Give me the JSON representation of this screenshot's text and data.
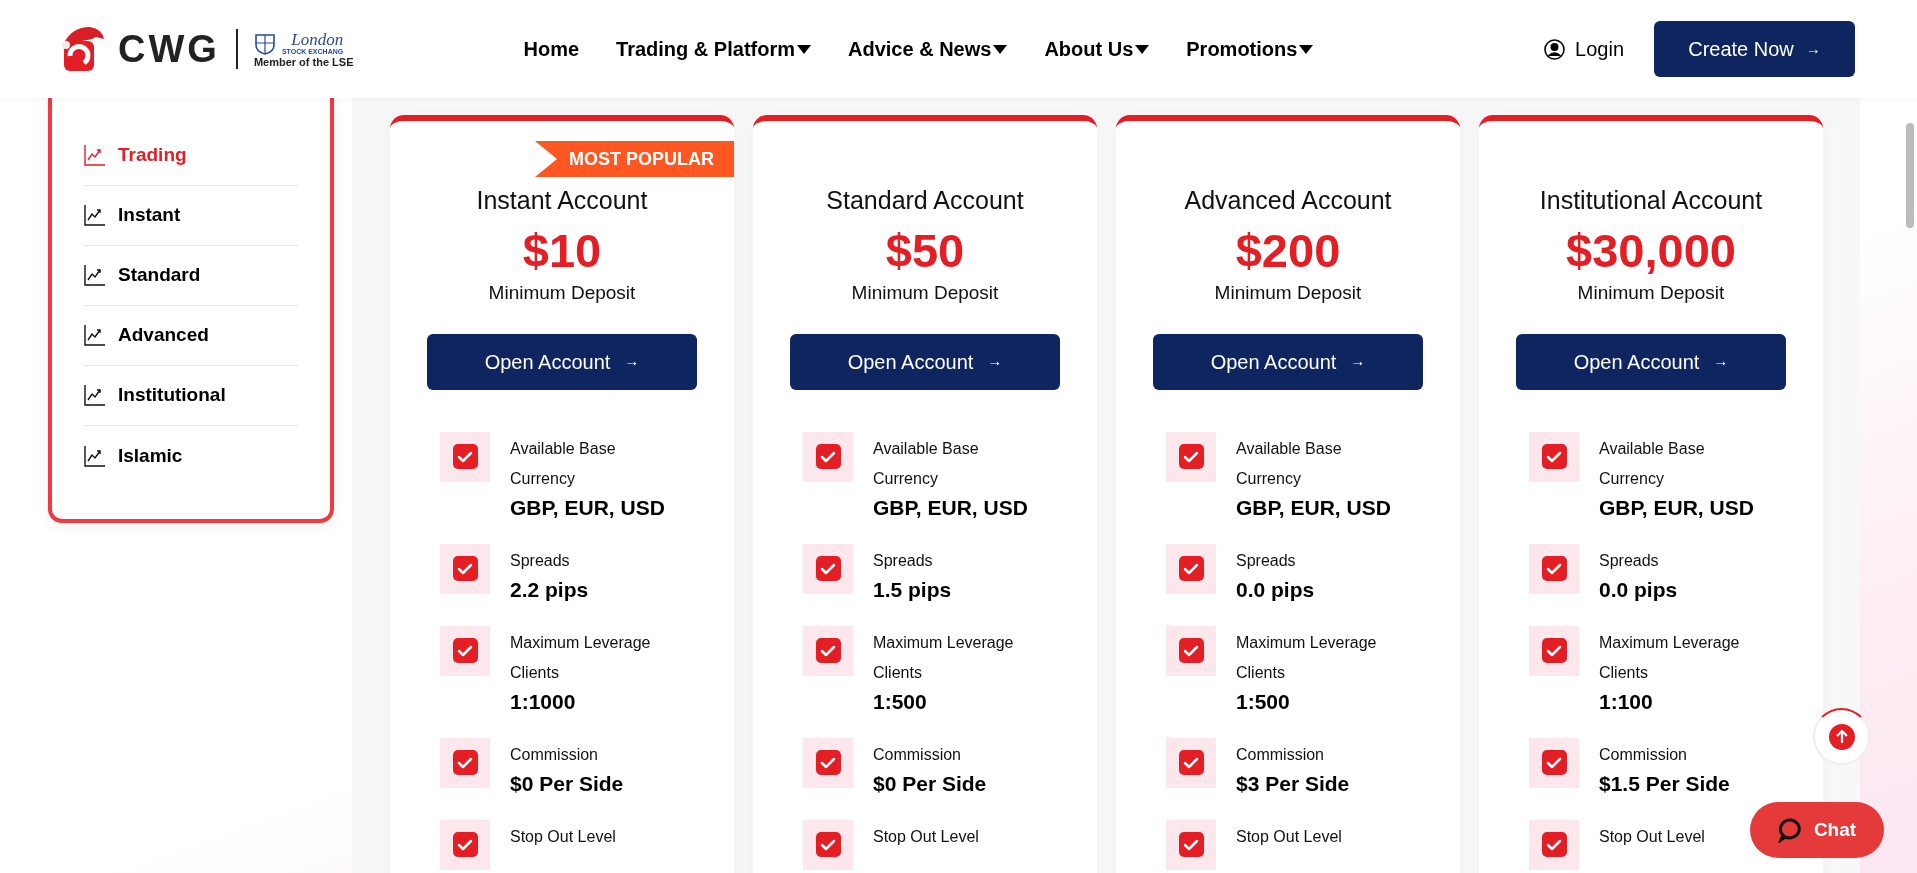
{
  "logo": {
    "brand": "CWG",
    "exchange": "London",
    "exchange_sub": "STOCK EXCHANG",
    "member": "Member of the LSE"
  },
  "nav": [
    {
      "label": "Home",
      "dropdown": false
    },
    {
      "label": "Trading & Platform",
      "dropdown": true
    },
    {
      "label": "Advice & News",
      "dropdown": true
    },
    {
      "label": "About Us",
      "dropdown": true
    },
    {
      "label": "Promotions",
      "dropdown": true
    }
  ],
  "login": "Login",
  "cta": {
    "label": "Create Now",
    "arrow": "→"
  },
  "sidebar": {
    "items": [
      {
        "label": "Trading",
        "selected": true
      },
      {
        "label": "Instant",
        "selected": false
      },
      {
        "label": "Standard",
        "selected": false
      },
      {
        "label": "Advanced",
        "selected": false
      },
      {
        "label": "Institutional",
        "selected": false
      },
      {
        "label": "Islamic",
        "selected": false
      }
    ]
  },
  "cards": [
    {
      "badge": "MOST POPULAR",
      "title": "Instant Account",
      "price": "$10",
      "price_label": "Minimum Deposit",
      "button": "Open Account",
      "arrow": "→",
      "features": [
        {
          "label": "Available Base Currency",
          "value": "GBP, EUR, USD",
          "checked": true
        },
        {
          "label": "Spreads",
          "value": "2.2 pips",
          "checked": true
        },
        {
          "label": "Maximum Leverage Clients",
          "value": "1:1000",
          "checked": true
        },
        {
          "label": "Commission",
          "value": "$0 Per Side",
          "checked": true
        },
        {
          "label": "Stop Out Level",
          "checked": true
        }
      ]
    },
    {
      "title": "Standard Account",
      "price": "$50",
      "price_label": "Minimum Deposit",
      "button": "Open Account",
      "arrow": "→",
      "features": [
        {
          "label": "Available Base Currency",
          "value": "GBP, EUR, USD",
          "checked": true
        },
        {
          "label": "Spreads",
          "value": "1.5 pips",
          "checked": true
        },
        {
          "label": "Maximum Leverage Clients",
          "value": "1:500",
          "checked": true
        },
        {
          "label": "Commission",
          "value": "$0 Per Side",
          "checked": true
        },
        {
          "label": "Stop Out Level",
          "checked": true
        }
      ]
    },
    {
      "title": "Advanced Account",
      "price": "$200",
      "price_label": "Minimum Deposit",
      "button": "Open Account",
      "arrow": "→",
      "features": [
        {
          "label": "Available Base Currency",
          "value": "GBP, EUR, USD",
          "checked": true
        },
        {
          "label": "Spreads",
          "value": "0.0 pips",
          "checked": true
        },
        {
          "label": "Maximum Leverage Clients",
          "value": "1:500",
          "checked": true
        },
        {
          "label": "Commission",
          "value": "$3 Per Side",
          "checked": true
        },
        {
          "label": "Stop Out Level",
          "checked": true
        }
      ]
    },
    {
      "title": "Institutional Account",
      "price": "$30,000",
      "price_label": "Minimum Deposit",
      "button": "Open Account",
      "arrow": "→",
      "features": [
        {
          "label": "Available Base Currency",
          "value": "GBP, EUR, USD",
          "checked": true
        },
        {
          "label": "Spreads",
          "value": "0.0 pips",
          "checked": true
        },
        {
          "label": "Maximum Leverage Clients",
          "value": "1:100",
          "checked": true
        },
        {
          "label": "Commission",
          "value": "$1.5 Per Side",
          "checked": true
        },
        {
          "label": "Stop Out Level",
          "checked": true
        }
      ]
    }
  ],
  "chat": {
    "label": "Chat"
  }
}
